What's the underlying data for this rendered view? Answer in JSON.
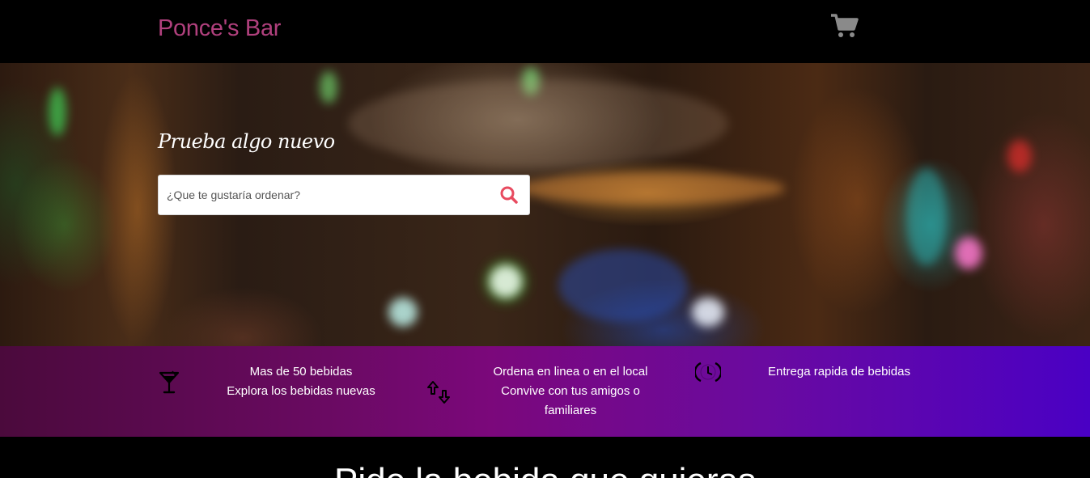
{
  "header": {
    "brand": "Ponce's Bar",
    "cart_icon": "shopping-cart-icon"
  },
  "hero": {
    "title": "Prueba algo nuevo",
    "search": {
      "placeholder": "¿Que te gustaría ordenar?",
      "value": "",
      "icon": "search-icon",
      "icon_color": "#e84a5f"
    }
  },
  "features": [
    {
      "icon": "cocktail-glass-icon",
      "line1": "Mas de 50 bebidas",
      "line2": "Explora los bebidas nuevas",
      "line3": ""
    },
    {
      "icon": "up-down-arrows-icon",
      "line1": "Ordena en linea o en el local",
      "line2": "Convive con tus amigos o",
      "line3": "familiares"
    },
    {
      "icon": "clock-icon",
      "line1": "Entrega rapida de bebidas",
      "line2": "",
      "line3": ""
    }
  ],
  "section": {
    "heading": "Pide la bebida que quieras"
  },
  "colors": {
    "brand": "#b0407d",
    "strip_start": "#4b0a3c",
    "strip_end": "#4a00c4",
    "cart": "#8a8a8a"
  }
}
